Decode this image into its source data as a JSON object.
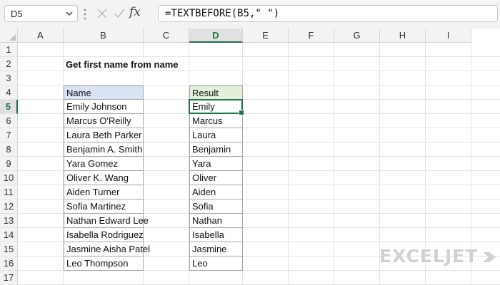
{
  "formula_bar": {
    "name_box": "D5",
    "formula": "=TEXTBEFORE(B5,\" \")",
    "icons": [
      "chevron-down-icon",
      "more-vertical-icon",
      "cancel-x-icon",
      "confirm-check-icon",
      "function-fx-icon"
    ],
    "fx_label": "fx"
  },
  "columns": [
    "A",
    "B",
    "C",
    "D",
    "E",
    "F",
    "G",
    "H",
    "I"
  ],
  "selected_column": "D",
  "rows": [
    "1",
    "2",
    "3",
    "4",
    "5",
    "6",
    "7",
    "8",
    "9",
    "10",
    "11",
    "12",
    "13",
    "14",
    "15",
    "16",
    "17"
  ],
  "selected_row": "5",
  "sheet": {
    "title": "Get first name from name",
    "name_header": "Name",
    "result_header": "Result",
    "names": [
      "Emily Johnson",
      "Marcus O'Reilly",
      "Laura Beth Parker",
      "Benjamin A. Smith",
      "Yara Gomez",
      "Oliver K. Wang",
      "Aiden Turner",
      "Sofia Martinez",
      "Nathan Edward Lee",
      "Isabella Rodriguez",
      "Jasmine Aisha Patel",
      "Leo Thompson"
    ],
    "results": [
      "Emily",
      "Marcus",
      "Laura",
      "Benjamin",
      "Yara",
      "Oliver",
      "Aiden",
      "Sofia",
      "Nathan",
      "Isabella",
      "Jasmine",
      "Leo"
    ],
    "active_cell": "D5"
  },
  "colors": {
    "selection": "#217346",
    "name_header_fill": "#dae3f3",
    "result_header_fill": "#e2efda",
    "logo": "#d0d0d0"
  },
  "logo": {
    "text": "EXCELJET",
    "icon": "exceljet-logo-icon"
  }
}
